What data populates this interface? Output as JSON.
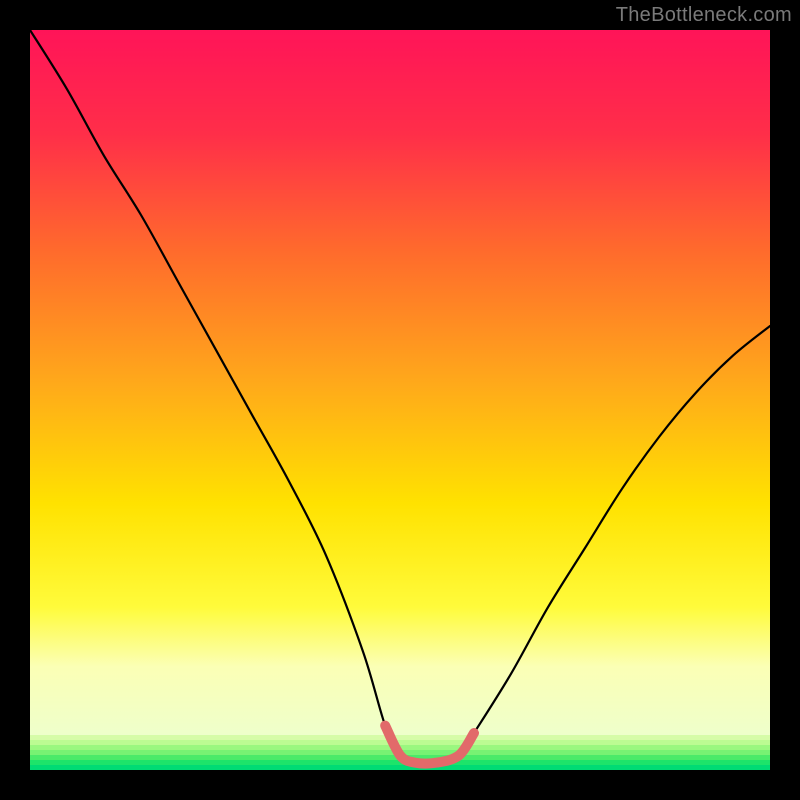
{
  "attribution": "TheBottleneck.com",
  "colors": {
    "frame": "#000000",
    "gradient_stops": [
      {
        "pct": 0,
        "color": "#ff1458"
      },
      {
        "pct": 14,
        "color": "#ff2e49"
      },
      {
        "pct": 30,
        "color": "#ff6b2c"
      },
      {
        "pct": 48,
        "color": "#ffaa1a"
      },
      {
        "pct": 64,
        "color": "#ffe200"
      },
      {
        "pct": 78,
        "color": "#fffb3b"
      },
      {
        "pct": 86,
        "color": "#fbffb5"
      },
      {
        "pct": 100,
        "color": "#e8ffd6"
      }
    ],
    "green_bands": [
      "#d6fca8",
      "#bcfb92",
      "#9af77f",
      "#77f273",
      "#4aea69",
      "#1de46a",
      "#00db74"
    ],
    "curve": "#000000",
    "highlight": "#e26a6a"
  },
  "chart_data": {
    "type": "line",
    "title": "",
    "xlabel": "",
    "ylabel": "",
    "xlim": [
      0,
      100
    ],
    "ylim": [
      0,
      100
    ],
    "annotations": [
      "TheBottleneck.com"
    ],
    "series": [
      {
        "name": "bottleneck-curve",
        "x": [
          0,
          5,
          10,
          15,
          20,
          25,
          30,
          35,
          40,
          45,
          48,
          50,
          52,
          55,
          58,
          60,
          65,
          70,
          75,
          80,
          85,
          90,
          95,
          100
        ],
        "y": [
          100,
          92,
          83,
          75,
          66,
          57,
          48,
          39,
          29,
          16,
          6,
          2,
          1,
          1,
          2,
          5,
          13,
          22,
          30,
          38,
          45,
          51,
          56,
          60
        ]
      },
      {
        "name": "highlight-segment",
        "x": [
          48,
          50,
          52,
          55,
          58,
          60
        ],
        "y": [
          6,
          2,
          1,
          1,
          2,
          5
        ]
      }
    ]
  }
}
